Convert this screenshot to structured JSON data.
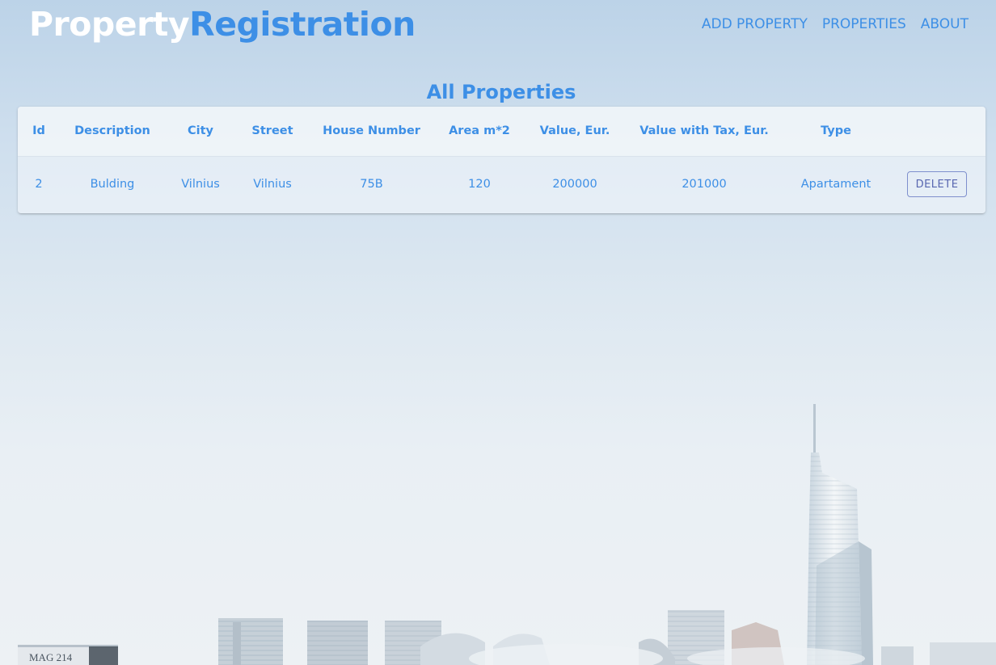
{
  "header": {
    "brand_part1": "Property",
    "brand_part2": "Registration",
    "nav": [
      "ADD PROPERTY",
      "PROPERTIES",
      "ABOUT"
    ]
  },
  "main": {
    "title": "All Properties",
    "table": {
      "columns": [
        "Id",
        "Description",
        "City",
        "Street",
        "House Number",
        "Area m*2",
        "Value, Eur.",
        "Value with Tax, Eur.",
        "Type",
        ""
      ],
      "rows": [
        {
          "id": "2",
          "description": "Bulding",
          "city": "Vilnius",
          "street": "Vilnius",
          "house_number": "75B",
          "area": "120",
          "value": "200000",
          "value_with_tax": "201000",
          "type": "Apartament",
          "action_label": "DELETE"
        }
      ]
    }
  },
  "background": {
    "sign_text": "MAG 214"
  },
  "colors": {
    "accent": "#3d8fe6",
    "brand_light": "#ffffff",
    "delete_border": "#7e8fcd",
    "delete_text": "#5766b0"
  }
}
